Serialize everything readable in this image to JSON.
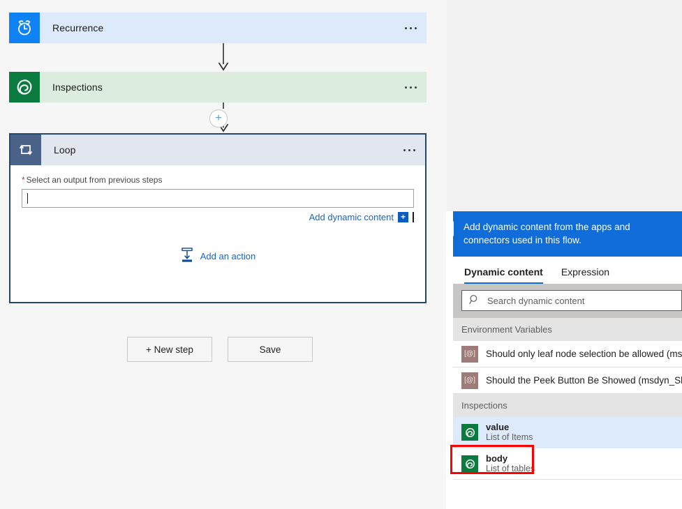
{
  "designer": {
    "cards": [
      {
        "id": "recurrence",
        "title": "Recurrence",
        "icon": "alarm-clock-icon"
      },
      {
        "id": "inspections",
        "title": "Inspections",
        "icon": "dataverse-icon"
      },
      {
        "id": "loop",
        "title": "Loop",
        "icon": "loop-icon"
      }
    ],
    "loop": {
      "field_label": "Select an output from previous steps",
      "required_marker": "*",
      "field_value": "",
      "add_dynamic_content_label": "Add dynamic content",
      "plus_chip_label": "+",
      "add_action_label": "Add an action"
    },
    "menu_glyph": "ellipsis-icon",
    "plus_node_label": "+",
    "buttons": [
      {
        "id": "new-step",
        "label": "+ New step"
      },
      {
        "id": "save",
        "label": "Save"
      }
    ]
  },
  "panel": {
    "header_text": "Add dynamic content from the apps and connectors used in this flow.",
    "tabs": [
      {
        "id": "dynamic-content",
        "label": "Dynamic content",
        "active": true
      },
      {
        "id": "expression",
        "label": "Expression",
        "active": false
      }
    ],
    "search": {
      "placeholder": "Search dynamic content",
      "value": "",
      "icon": "search-icon"
    },
    "groups": [
      {
        "id": "environment-variables",
        "title": "Environment Variables",
        "items": [
          {
            "icon": "environment-variable-icon",
            "icon_glyph": "[@]",
            "label": "Should only leaf node selection be allowed (msdyn_AllowOnlyLeafNodeSelection)",
            "two_line": false
          },
          {
            "icon": "environment-variable-icon",
            "icon_glyph": "[@]",
            "label": "Should the Peek Button Be Showed (msdyn_ShouldShowPeekButton)",
            "two_line": false
          }
        ]
      },
      {
        "id": "inspections",
        "title": "Inspections",
        "items": [
          {
            "icon": "dataverse-icon",
            "name": "value",
            "sub": "List of Items",
            "two_line": true,
            "selected": true,
            "highlighted": true
          },
          {
            "icon": "dataverse-icon",
            "name": "body",
            "sub": "List of tables",
            "two_line": true,
            "selected": false,
            "highlighted": false
          }
        ]
      }
    ]
  },
  "colors": {
    "accent_blue": "#0f6cd8",
    "recurrence_icon": "#0f83f5",
    "recurrence_body": "#dceafc",
    "dataverse_green": "#0b7a3e",
    "inspections_body": "#dcecdf",
    "loop_icon": "#4a6287",
    "loop_header": "#e2e6ef",
    "loop_border": "#22486f",
    "link_blue": "#1a65c0",
    "required_red": "#d13438",
    "highlight_red": "#ff0000",
    "selected_row": "#ddeafb",
    "envvar_icon": "#9d7b79"
  }
}
